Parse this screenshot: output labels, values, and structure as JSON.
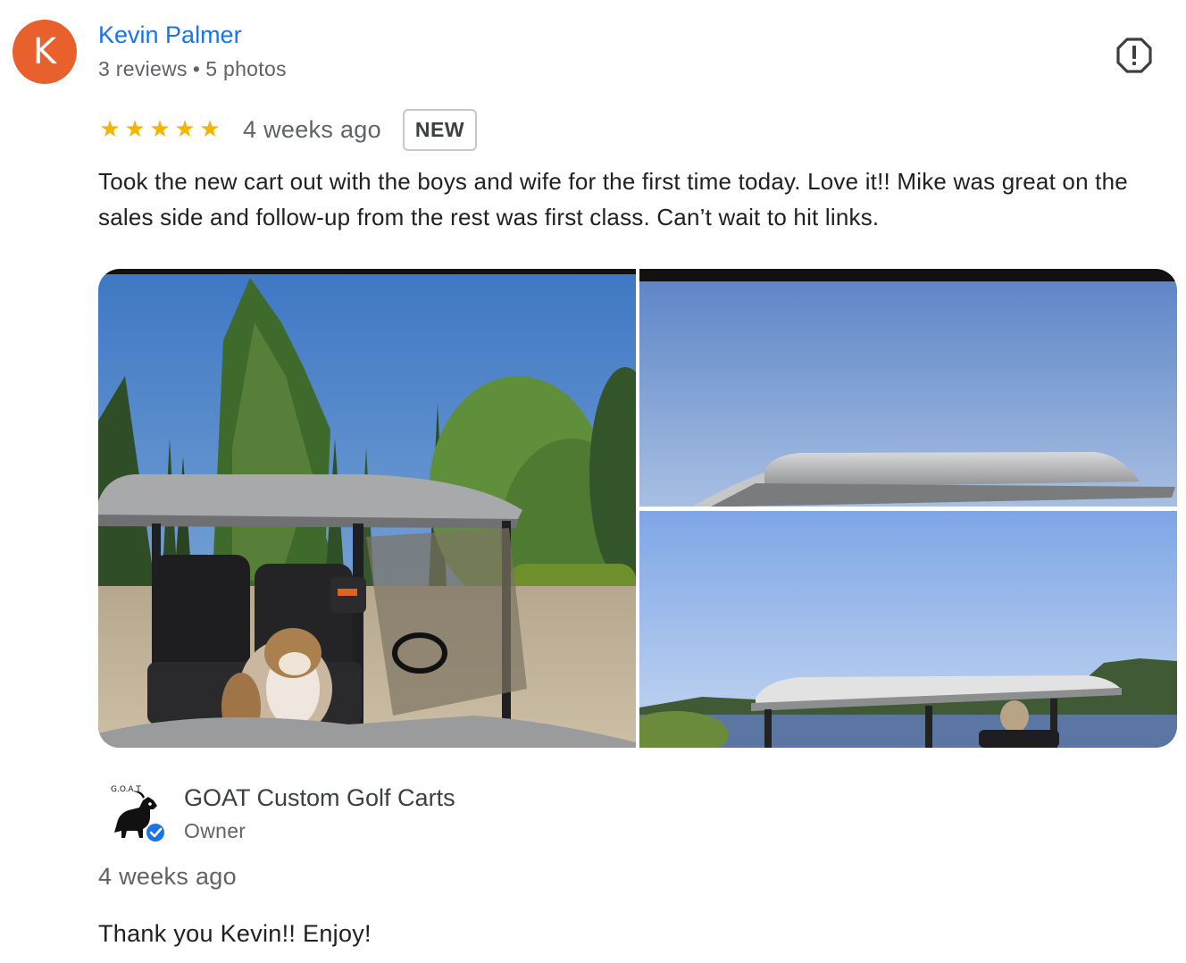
{
  "review": {
    "avatar_letter": "K",
    "avatar_color": "#e8602c",
    "reviewer_name": "Kevin Palmer",
    "reviews_count": "3 reviews",
    "separator": "•",
    "photos_count": "5 photos",
    "rating": 5,
    "stars": [
      "★",
      "★",
      "★",
      "★",
      "★"
    ],
    "time_ago": "4 weeks ago",
    "badge": "NEW",
    "text": "Took the new cart out with the boys and wife for the first time today. Love it!! Mike was great on the sales side and follow-up from the rest was first class. Can’t wait to hit links.",
    "report_icon": "report-flag-icon",
    "photos": [
      {
        "name": "golf-cart-with-bulldog-photo"
      },
      {
        "name": "cart-roof-sky-photo"
      },
      {
        "name": "cart-by-lake-photo"
      }
    ]
  },
  "owner_reply": {
    "logo_icon": "goat-logo-icon",
    "logo_text": "G.O.A.T",
    "verified_icon": "verified-check-icon",
    "name": "GOAT Custom Golf Carts",
    "role": "Owner",
    "time_ago": "4 weeks ago",
    "text": "Thank you Kevin!! Enjoy!"
  },
  "colors": {
    "link_blue": "#1a73e8",
    "star_gold": "#f4b400",
    "secondary_text": "#5f6368",
    "verified_blue": "#1a73e8"
  }
}
